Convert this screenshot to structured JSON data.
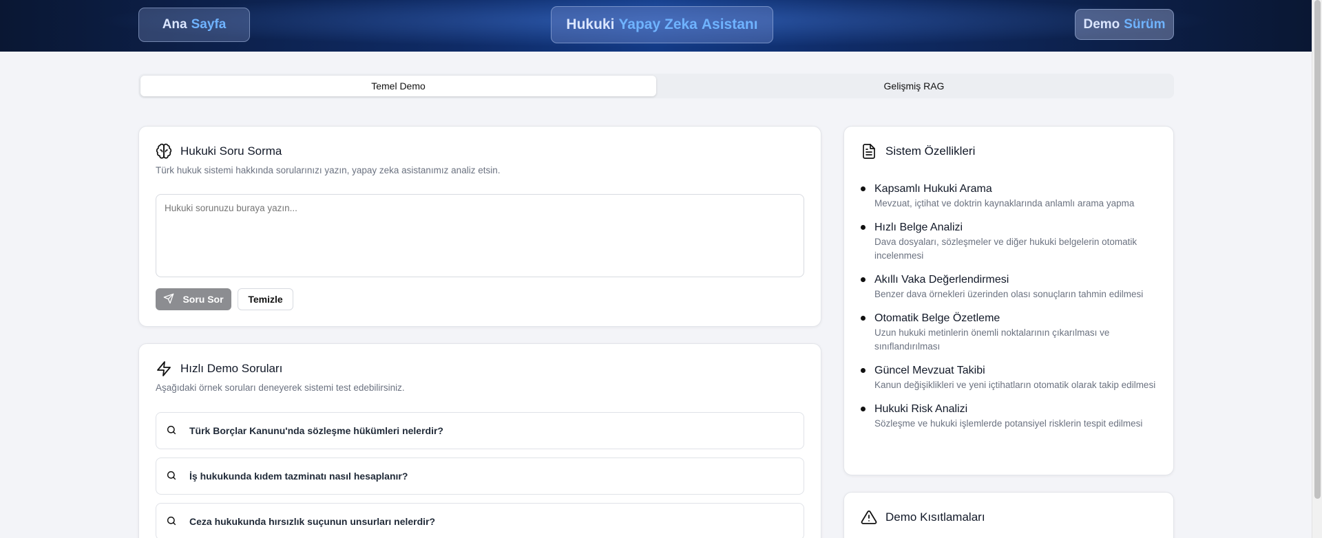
{
  "header": {
    "home_word1": "Ana",
    "home_word2": "Sayfa",
    "title_word1": "Hukuki",
    "title_word2": "Yapay Zeka",
    "title_word3": "Asistanı",
    "badge_word1": "Demo",
    "badge_word2": "Sürüm"
  },
  "tabs": [
    {
      "label": "Temel Demo",
      "active": true
    },
    {
      "label": "Gelişmiş RAG",
      "active": false
    }
  ],
  "ask": {
    "title": "Hukuki Soru Sorma",
    "description": "Türk hukuk sistemi hakkında sorularınızı yazın, yapay zeka asistanımız analiz etsin.",
    "placeholder": "Hukuki sorunuzu buraya yazın...",
    "submit_label": "Soru Sor",
    "clear_label": "Temizle"
  },
  "quick": {
    "title": "Hızlı Demo Soruları",
    "description": "Aşağıdaki örnek soruları deneyerek sistemi test edebilirsiniz.",
    "questions": [
      "Türk Borçlar Kanunu'nda sözleşme hükümleri nelerdir?",
      "İş hukukunda kıdem tazminatı nasıl hesaplanır?",
      "Ceza hukukunda hırsızlık suçunun unsurları nelerdir?"
    ]
  },
  "features": {
    "title": "Sistem Özellikleri",
    "items": [
      {
        "title": "Kapsamlı Hukuki Arama",
        "desc": "Mevzuat, içtihat ve doktrin kaynaklarında anlamlı arama yapma"
      },
      {
        "title": "Hızlı Belge Analizi",
        "desc": "Dava dosyaları, sözleşmeler ve diğer hukuki belgelerin otomatik incelenmesi"
      },
      {
        "title": "Akıllı Vaka Değerlendirmesi",
        "desc": "Benzer dava örnekleri üzerinden olası sonuçların tahmin edilmesi"
      },
      {
        "title": "Otomatik Belge Özetleme",
        "desc": "Uzun hukuki metinlerin önemli noktalarının çıkarılması ve sınıflandırılması"
      },
      {
        "title": "Güncel Mevzuat Takibi",
        "desc": "Kanun değişiklikleri ve yeni içtihatların otomatik olarak takip edilmesi"
      },
      {
        "title": "Hukuki Risk Analizi",
        "desc": "Sözleşme ve hukuki işlemlerde potansiyel risklerin tespit edilmesi"
      }
    ]
  },
  "limits": {
    "title": "Demo Kısıtlamaları"
  },
  "colors": {
    "accent_blue": "#6fb3ff",
    "header_dark": "#0a1733",
    "submit_button": "#8c8d91"
  }
}
